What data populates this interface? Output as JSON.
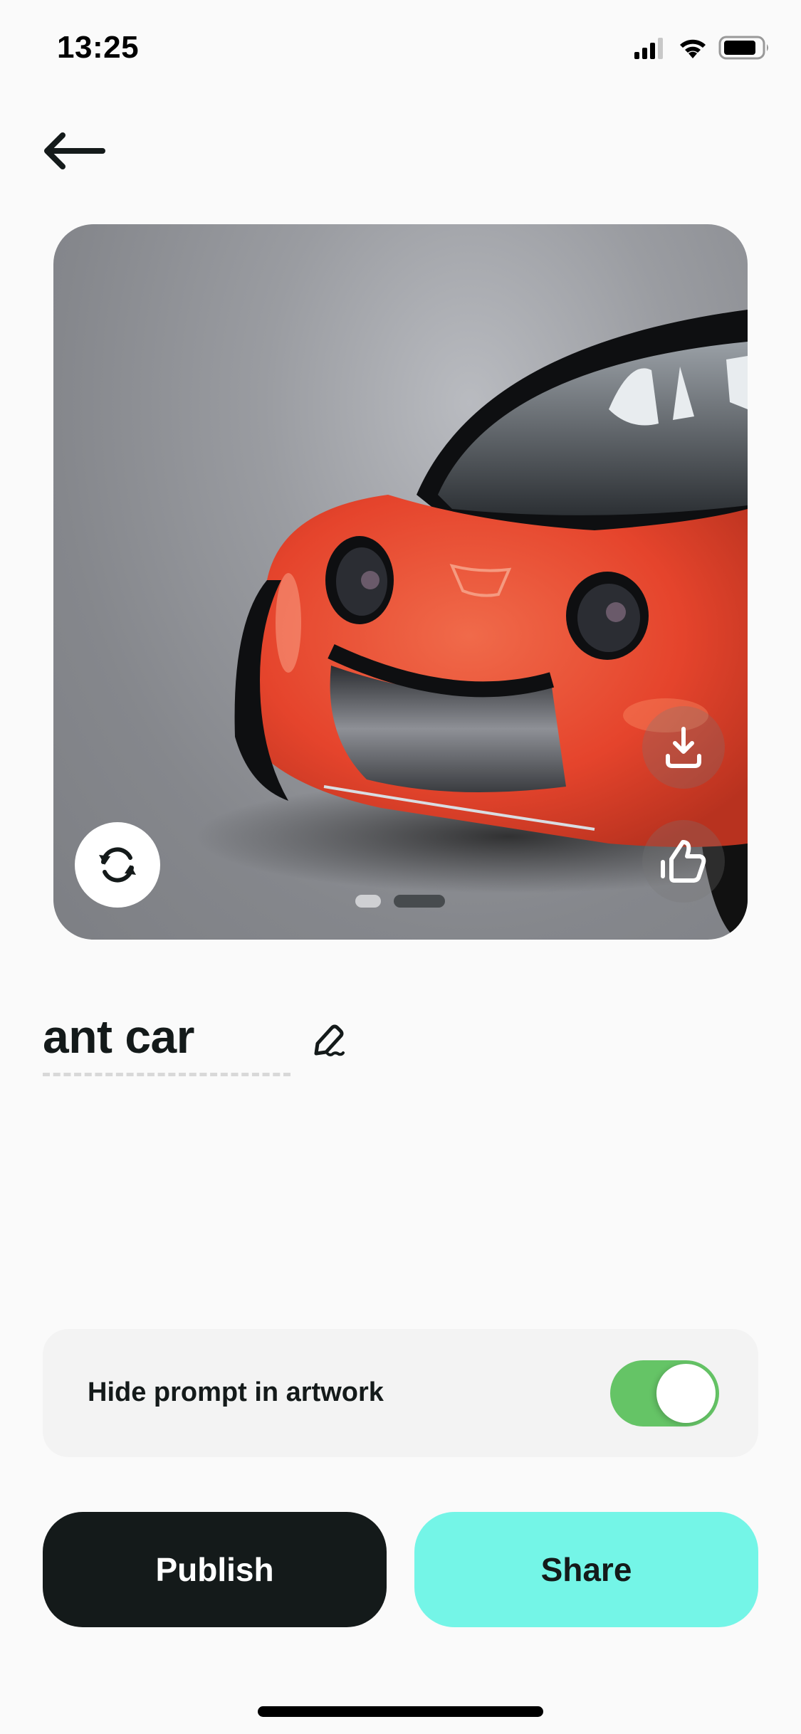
{
  "status_bar": {
    "time": "13:25",
    "icons": [
      "cellular-signal-icon",
      "wifi-icon",
      "battery-icon"
    ]
  },
  "nav": {
    "back_icon": "arrow-left-icon"
  },
  "artwork": {
    "image_description": "Red cartoon car with smiling face and round headlight eyes on grey background",
    "regenerate_icon": "refresh-icon",
    "download_icon": "download-icon",
    "like_icon": "thumbs-up-icon",
    "pagination": {
      "total": 2,
      "active_index": 1
    }
  },
  "title": {
    "text": "ant car",
    "edit_icon": "pencil-icon"
  },
  "settings": {
    "hide_prompt_label": "Hide prompt in artwork",
    "hide_prompt_enabled": true
  },
  "actions": {
    "publish_label": "Publish",
    "share_label": "Share"
  },
  "colors": {
    "background": "#fafafa",
    "primary_dark": "#141a1a",
    "accent_teal": "#74f5e7",
    "toggle_on": "#65c466"
  }
}
